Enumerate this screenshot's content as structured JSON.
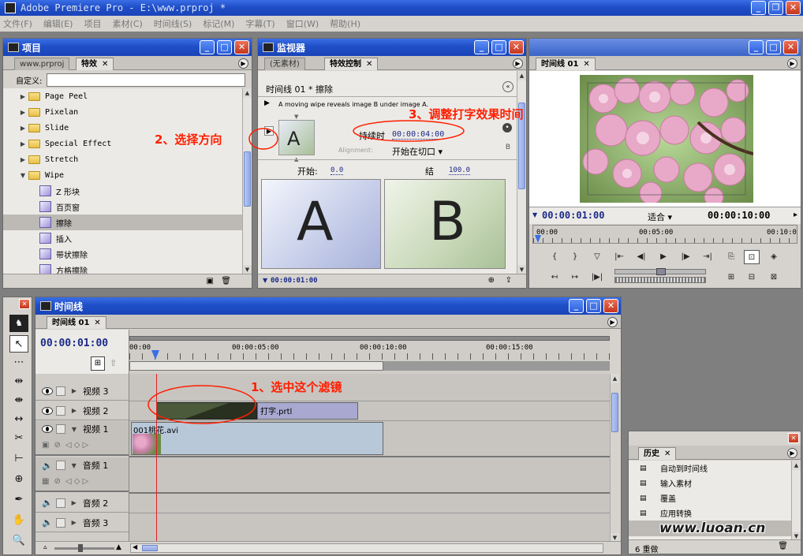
{
  "app_title": "Adobe Premiere Pro - E:\\www.prproj *",
  "menubar": [
    "文件(F)",
    "编辑(E)",
    "项目",
    "素材(C)",
    "时间线(S)",
    "标记(M)",
    "字幕(T)",
    "窗口(W)",
    "帮助(H)"
  ],
  "project_panel": {
    "title": "项目",
    "tabs": [
      "www.prproj",
      "特效"
    ],
    "custom_label": "自定义:",
    "custom_value": "",
    "items": [
      {
        "label": "Page Peel",
        "kind": "folder"
      },
      {
        "label": "Pixelan",
        "kind": "folder"
      },
      {
        "label": "Slide",
        "kind": "folder"
      },
      {
        "label": "Special Effect",
        "kind": "folder"
      },
      {
        "label": "Stretch",
        "kind": "folder"
      },
      {
        "label": "Wipe",
        "kind": "folder-open"
      },
      {
        "label": "Z 形块",
        "kind": "effect"
      },
      {
        "label": "百页窗",
        "kind": "effect"
      },
      {
        "label": "擦除",
        "kind": "effect",
        "selected": true
      },
      {
        "label": "插入",
        "kind": "effect"
      },
      {
        "label": "带状擦除",
        "kind": "effect"
      },
      {
        "label": "方格擦除",
        "kind": "effect"
      }
    ]
  },
  "monitor_panel": {
    "title": "监视器",
    "tabs": [
      "(无素材)",
      "特效控制"
    ],
    "sequence_label": "时间线 01 * 擦除",
    "description": "A moving wipe reveals image B under image A.",
    "duration_label": "持续时",
    "duration_value": "00:00:04:00",
    "alignment_label": "Alignment:",
    "alignment_value": "开始在切口",
    "start_label": "开始:",
    "start_value": "0.0",
    "end_label": "结",
    "end_value": "100.0",
    "letter_a": "A",
    "letter_b": "B",
    "thumb_letter": "A",
    "corner_b": "B",
    "timecode": "00:00:01:00"
  },
  "program_panel": {
    "tab": "时间线 01",
    "current_time": "00:00:01:00",
    "fit_label": "适合",
    "duration": "00:00:10:00",
    "ruler": [
      "00:00",
      "00:05:00",
      "00:10:0"
    ]
  },
  "timeline_panel": {
    "title": "时间线",
    "tab": "时间线 01",
    "current_time": "00:00:01:00",
    "ruler": [
      "00:00",
      "00:00:05:00",
      "00:00:10:00",
      "00:00:15:00"
    ],
    "tracks": [
      {
        "name": "视频 3",
        "type": "video"
      },
      {
        "name": "视频 2",
        "type": "video"
      },
      {
        "name": "视频 1",
        "type": "video"
      },
      {
        "name": "音频 1",
        "type": "audio"
      },
      {
        "name": "音频 2",
        "type": "audio"
      },
      {
        "name": "音频 3",
        "type": "audio"
      }
    ],
    "clip_title": "打字.prtl",
    "clip_video": "001桃花.avi"
  },
  "history_panel": {
    "tab": "历史",
    "items": [
      "自动到时间线",
      "输入素材",
      "覆盖",
      "应用转换"
    ],
    "footer": "6 重做"
  },
  "annotations": {
    "step1": "1、选中这个滤镜",
    "step2": "2、选择方向",
    "step3": "3、调整打字效果时间"
  },
  "watermark": "www.luoan.cn",
  "colors": {
    "titlebar": "#1f4fc8",
    "annotation": "#ff1e00",
    "timecode": "#1a2a8a"
  }
}
